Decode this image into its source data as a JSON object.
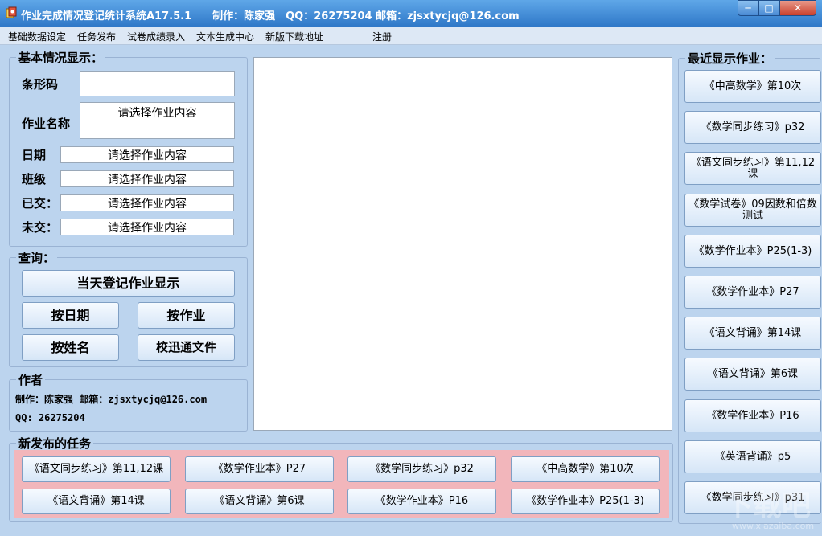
{
  "window": {
    "title": "作业完成情况登记统计系统A17.5.1　　制作：陈家强　QQ：26275204 邮箱：zjsxtycjq@126.com",
    "min_label": "─",
    "max_label": "□",
    "close_label": "✕"
  },
  "menu": [
    "基础数据设定",
    "任务发布",
    "试卷成绩录入",
    "文本生成中心",
    "新版下载地址",
    "注册"
  ],
  "basic_info": {
    "title": "基本情况显示：",
    "barcode_label": "条形码",
    "barcode_value": "",
    "homework_name_label": "作业名称",
    "homework_name_value": "请选择作业内容",
    "date_label": "日期",
    "date_value": "请选择作业内容",
    "class_label": "班级",
    "class_value": "请选择作业内容",
    "submitted_label": "已交：",
    "submitted_value": "请选择作业内容",
    "not_submitted_label": "未交：",
    "not_submitted_value": "请选择作业内容"
  },
  "query": {
    "title": "查询：",
    "today_button": "当天登记作业显示",
    "by_date_button": "按日期",
    "by_homework_button": "按作业",
    "by_name_button": "按姓名",
    "xunxuntong_button": "校迅通文件"
  },
  "author": {
    "title": "作者",
    "line1": "制作：陈家强 邮箱：zjsxtycjq@126.com",
    "line2": "QQ: 26275204"
  },
  "recent": {
    "title": "最近显示作业：",
    "items": [
      "《中高数学》第10次",
      "《数学同步练习》p32",
      "《语文同步练习》第11,12课",
      "《数学试卷》09因数和倍数测试",
      "《数学作业本》P25(1-3)",
      "《数学作业本》P27",
      "《语文背诵》第14课",
      "《语文背诵》第6课",
      "《数学作业本》P16",
      "《英语背诵》p5",
      "《数学同步练习》p31"
    ]
  },
  "tasks": {
    "title": "新发布的任务",
    "items": [
      "《语文同步练习》第11,12课",
      "《数学作业本》P27",
      "《数学同步练习》p32",
      "《中高数学》第10次",
      "《语文背诵》第14课",
      "《语文背诵》第6课",
      "《数学作业本》P16",
      "《数学作业本》P25(1-3)"
    ]
  },
  "watermark": {
    "text": "下载吧",
    "sub": "www.xiazaiba.com"
  },
  "colors": {
    "background": "#bcd4ee",
    "titlebar": "#2f78c8",
    "tasks_area": "#f2b6bb"
  }
}
